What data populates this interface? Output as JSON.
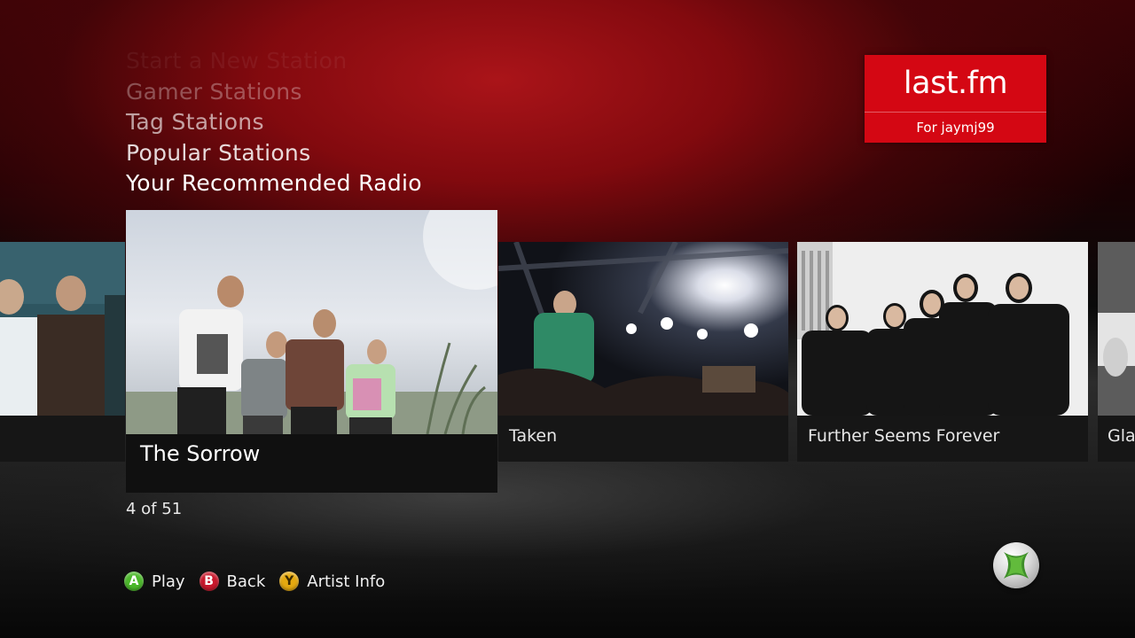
{
  "menu": {
    "items": [
      {
        "label": "Start a New Station"
      },
      {
        "label": "Gamer Stations"
      },
      {
        "label": "Tag Stations"
      },
      {
        "label": "Popular Stations"
      },
      {
        "label": "Your Recommended Radio"
      }
    ],
    "selected": "Your Recommended Radio"
  },
  "brand": {
    "logo_text": "last.fm",
    "user_label": "For jaymj99",
    "color": "#d40713"
  },
  "stations": [
    {
      "name": ""
    },
    {
      "name": "The Sorrow",
      "focused": true
    },
    {
      "name": "Taken"
    },
    {
      "name": "Further Seems Forever"
    },
    {
      "name": "Gla"
    }
  ],
  "counter": "4 of 51",
  "hints": [
    {
      "button": "A",
      "label": "Play",
      "color": "#4bb82a"
    },
    {
      "button": "B",
      "label": "Back",
      "color": "#c9182c"
    },
    {
      "button": "Y",
      "label": "Artist Info",
      "color": "#e5a910"
    }
  ],
  "icons": {
    "xbox": "xbox-logo-icon"
  }
}
